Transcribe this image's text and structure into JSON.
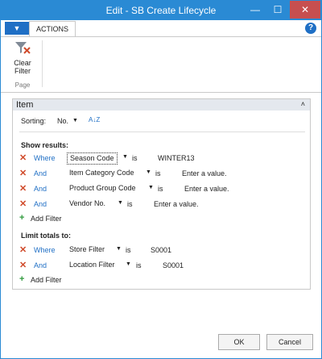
{
  "window": {
    "title": "Edit - SB Create Lifecycle",
    "minimize_glyph": "—",
    "maximize_glyph": "☐",
    "close_glyph": "✕",
    "title_bar_color": "#2a8ad4",
    "close_color": "#c74f4f"
  },
  "ribbon": {
    "menu_glyph": "▼",
    "tab_label": "ACTIONS",
    "help_glyph": "?",
    "clear_filter_label_line1": "Clear",
    "clear_filter_label_line2": "Filter",
    "group_label": "Page"
  },
  "panel": {
    "title": "Item",
    "collapse_glyph": "˄",
    "sorting_label": "Sorting:",
    "sorting_value": "No.",
    "sort_dir_glyph": "A↓Z",
    "dropdown_glyph": "▼",
    "show_results_label": "Show results:",
    "show_results": [
      {
        "x": "✕",
        "keyword": "Where",
        "field": "Season Code",
        "op": "is",
        "value": "WINTER13"
      },
      {
        "x": "✕",
        "keyword": "And",
        "field": "Item Category Code",
        "op": "is",
        "value": "Enter a value."
      },
      {
        "x": "✕",
        "keyword": "And",
        "field": "Product Group Code",
        "op": "is",
        "value": "Enter a value."
      },
      {
        "x": "✕",
        "keyword": "And",
        "field": "Vendor No.",
        "op": "is",
        "value": "Enter a value."
      }
    ],
    "add_filter_label": "Add Filter",
    "add_filter_glyph": "+",
    "limit_totals_label": "Limit totals to:",
    "limit_totals": [
      {
        "x": "✕",
        "keyword": "Where",
        "field": "Store Filter",
        "op": "is",
        "value": "S0001"
      },
      {
        "x": "✕",
        "keyword": "And",
        "field": "Location Filter",
        "op": "is",
        "value": "S0001"
      }
    ]
  },
  "buttons": {
    "ok": "OK",
    "cancel": "Cancel"
  }
}
